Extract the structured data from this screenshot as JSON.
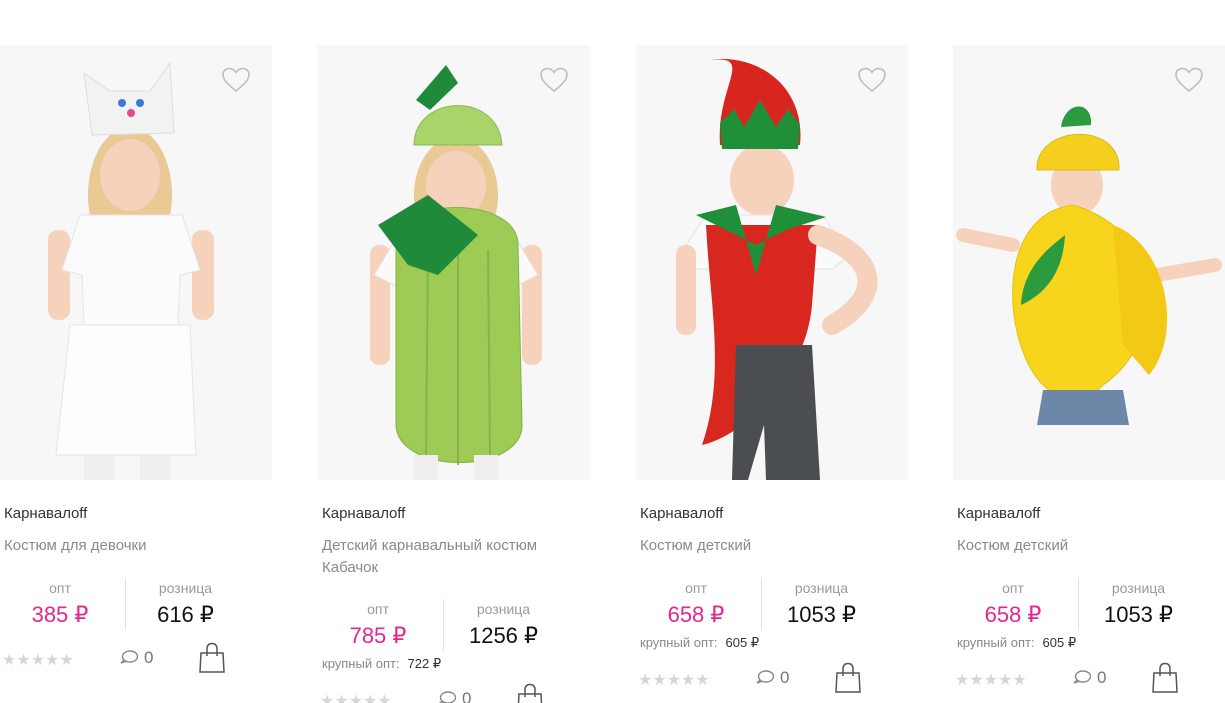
{
  "products": [
    {
      "brand": "Карнавалoff",
      "title": "Костюм для девочки",
      "price_opt_label": "опт",
      "price_opt": "385 ₽",
      "price_retail_label": "розница",
      "price_retail": "616 ₽",
      "bulk_label": "",
      "bulk_price": "",
      "rating_stars": 0,
      "comments": "0",
      "image": "girl-cat-costume"
    },
    {
      "brand": "Карнавалoff",
      "title": "Детский карнавальный костюм Кабачок",
      "price_opt_label": "опт",
      "price_opt": "785 ₽",
      "price_retail_label": "розница",
      "price_retail": "1256 ₽",
      "bulk_label": "крупный опт:",
      "bulk_price": "722 ₽",
      "rating_stars": 0,
      "comments": "0",
      "image": "girl-zucchini-costume"
    },
    {
      "brand": "Карнавалoff",
      "title": "Костюм детский",
      "price_opt_label": "опт",
      "price_opt": "658 ₽",
      "price_retail_label": "розница",
      "price_retail": "1053 ₽",
      "bulk_label": "крупный опт:",
      "bulk_price": "605 ₽",
      "rating_stars": 0,
      "comments": "0",
      "image": "boy-pepper-costume"
    },
    {
      "brand": "Карнавалoff",
      "title": "Костюм детский",
      "price_opt_label": "опт",
      "price_opt": "658 ₽",
      "price_retail_label": "розница",
      "price_retail": "1053 ₽",
      "bulk_label": "крупный опт:",
      "bulk_price": "605 ₽",
      "rating_stars": 0,
      "comments": "0",
      "image": "boy-lemon-costume"
    }
  ],
  "icons": {
    "favorite": "heart-outline-icon",
    "comments": "speech-bubble-icon",
    "cart": "shopping-bag-icon",
    "rating": "star-icon"
  },
  "colors": {
    "opt_price": "#e5268f",
    "retail_price": "#111111",
    "muted_text": "#8a8a8a",
    "stars": "#d6d6d6"
  }
}
